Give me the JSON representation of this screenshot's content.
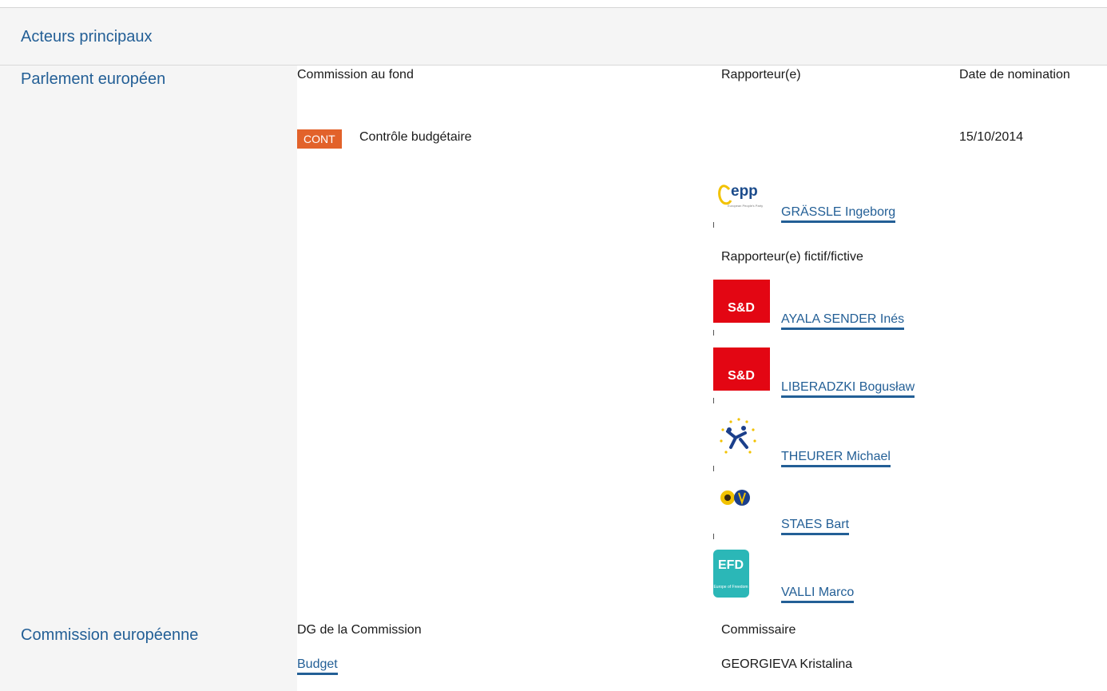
{
  "section": {
    "title": "Acteurs principaux"
  },
  "parliament": {
    "heading": "Parlement européen",
    "col_committee": "Commission au fond",
    "col_rapporteur": "Rapporteur(e)",
    "col_date": "Date de nomination",
    "committee_code": "CONT",
    "committee_name": "Contrôle budgétaire",
    "appointment_date": "15/10/2014",
    "rapporteur": {
      "name": "GRÄSSLE Ingeborg",
      "group_logo": "epp-logo"
    },
    "shadow_label": "Rapporteur(e) fictif/fictive",
    "shadows": [
      {
        "name": "AYALA SENDER Inés",
        "group_logo": "sd-logo",
        "logo_text": "S&D"
      },
      {
        "name": "LIBERADZKI Bogusław",
        "group_logo": "sd-logo",
        "logo_text": "S&D"
      },
      {
        "name": "THEURER Michael",
        "group_logo": "alde-logo"
      },
      {
        "name": "STAES Bart",
        "group_logo": "greens-efa-logo"
      },
      {
        "name": "VALLI Marco",
        "group_logo": "efd-logo",
        "logo_text": "EFD"
      }
    ]
  },
  "commission": {
    "heading": "Commission européenne",
    "col_dg": "DG de la Commission",
    "col_commissioner": "Commissaire",
    "dg": "Budget",
    "commissioner": "GEORGIEVA Kristalina"
  },
  "colors": {
    "link": "#235f96",
    "badge": "#e2622a",
    "band": "#f5f5f5"
  }
}
